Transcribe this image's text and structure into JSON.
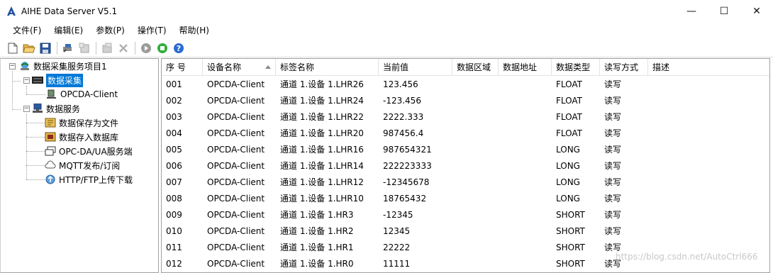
{
  "window": {
    "title": "AIHE Data Server V5.1",
    "minimize_glyph": "—",
    "maximize_glyph": "☐",
    "close_glyph": "✕"
  },
  "menu": [
    {
      "label": "文件(F)"
    },
    {
      "label": "编辑(E)"
    },
    {
      "label": "参数(P)"
    },
    {
      "label": "操作(T)"
    },
    {
      "label": "帮助(H)"
    }
  ],
  "toolbar": {
    "icons": [
      "new-file-icon",
      "open-folder-icon",
      "save-icon",
      "add-channel-icon",
      "add-device-icon",
      "add-tag-icon",
      "delete-icon",
      "stop-icon",
      "start-icon",
      "help-icon"
    ]
  },
  "tree": {
    "root": "数据采集服务项目1",
    "collection": "数据采集",
    "client": "OPCDA-Client",
    "services": "数据服务",
    "items": [
      "数据保存为文件",
      "数据存入数据库",
      "OPC-DA/UA服务端",
      "MQTT发布/订阅",
      "HTTP/FTP上传下载"
    ]
  },
  "table": {
    "columns": [
      "序 号",
      "设备名称",
      "标签名称",
      "当前值",
      "数据区域",
      "数据地址",
      "数据类型",
      "读写方式",
      "描述"
    ],
    "sorted_column": "设备名称",
    "rows": [
      [
        "001",
        "OPCDA-Client",
        "通道 1.设备 1.LHR26",
        "123.456",
        "",
        "",
        "FLOAT",
        "读写",
        ""
      ],
      [
        "002",
        "OPCDA-Client",
        "通道 1.设备 1.LHR24",
        "-123.456",
        "",
        "",
        "FLOAT",
        "读写",
        ""
      ],
      [
        "003",
        "OPCDA-Client",
        "通道 1.设备 1.LHR22",
        "2222.333",
        "",
        "",
        "FLOAT",
        "读写",
        ""
      ],
      [
        "004",
        "OPCDA-Client",
        "通道 1.设备 1.LHR20",
        "987456.4",
        "",
        "",
        "FLOAT",
        "读写",
        ""
      ],
      [
        "005",
        "OPCDA-Client",
        "通道 1.设备 1.LHR16",
        "987654321",
        "",
        "",
        "LONG",
        "读写",
        ""
      ],
      [
        "006",
        "OPCDA-Client",
        "通道 1.设备 1.LHR14",
        "222223333",
        "",
        "",
        "LONG",
        "读写",
        ""
      ],
      [
        "007",
        "OPCDA-Client",
        "通道 1.设备 1.LHR12",
        "-12345678",
        "",
        "",
        "LONG",
        "读写",
        ""
      ],
      [
        "008",
        "OPCDA-Client",
        "通道 1.设备 1.LHR10",
        "18765432",
        "",
        "",
        "LONG",
        "读写",
        ""
      ],
      [
        "009",
        "OPCDA-Client",
        "通道 1.设备 1.HR3",
        "-12345",
        "",
        "",
        "SHORT",
        "读写",
        ""
      ],
      [
        "010",
        "OPCDA-Client",
        "通道 1.设备 1.HR2",
        "12345",
        "",
        "",
        "SHORT",
        "读写",
        ""
      ],
      [
        "011",
        "OPCDA-Client",
        "通道 1.设备 1.HR1",
        "22222",
        "",
        "",
        "SHORT",
        "读写",
        ""
      ],
      [
        "012",
        "OPCDA-Client",
        "通道 1.设备 1.HR0",
        "11111",
        "",
        "",
        "SHORT",
        "读写",
        ""
      ]
    ]
  },
  "watermark": "https://blog.csdn.net/AutoCtrl666",
  "colors": {
    "selection": "#0078d7",
    "grid_line": "#e3e3e3",
    "border": "#a0a0a0"
  }
}
